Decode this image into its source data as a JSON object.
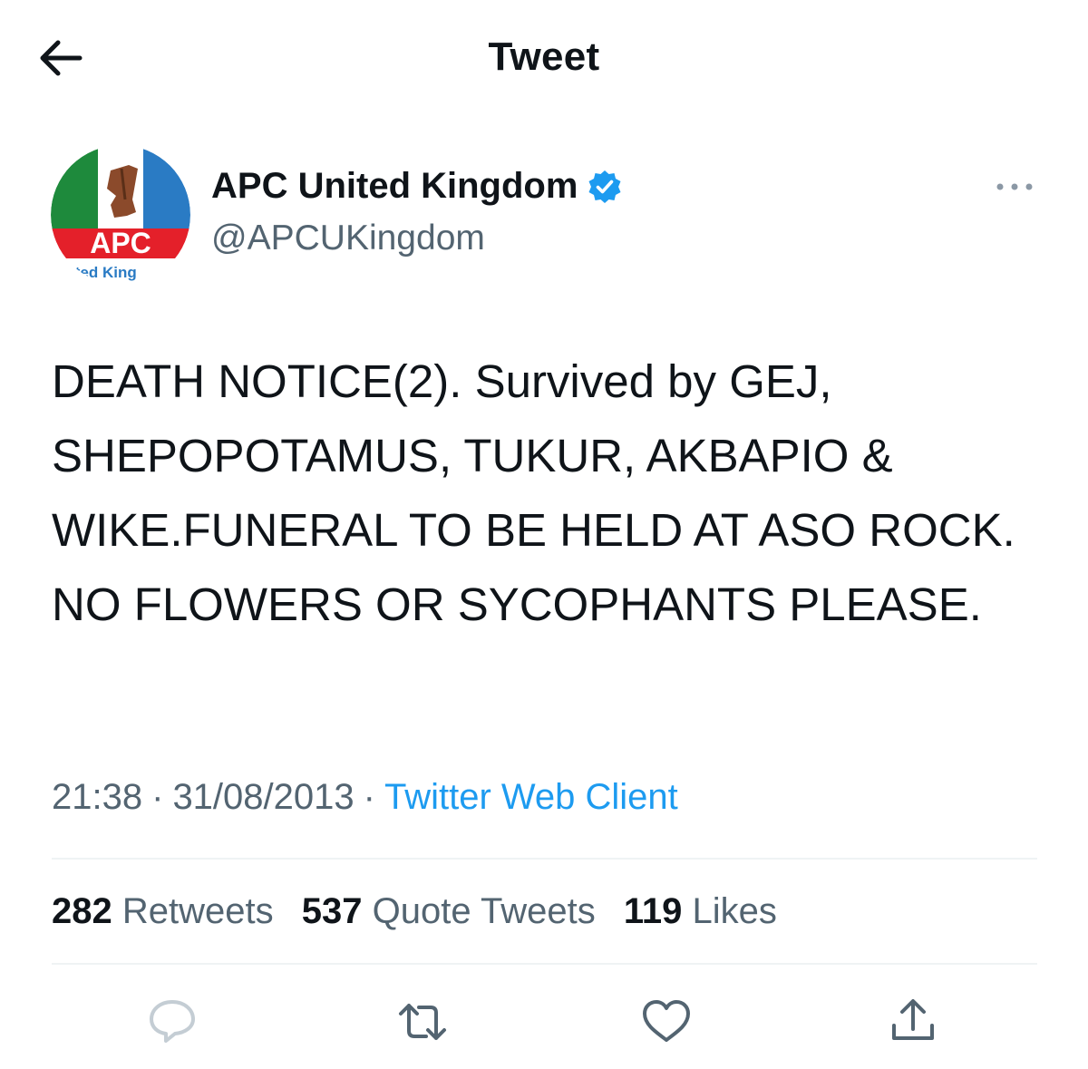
{
  "header": {
    "title": "Tweet",
    "back_icon": "arrow-left-icon"
  },
  "author": {
    "display_name": "APC United Kingdom",
    "handle": "@APCUKingdom",
    "verified": true,
    "avatar": {
      "logo_text": "APC",
      "caption": "ited King"
    }
  },
  "tweet": {
    "text": "DEATH NOTICE(2). Survived by GEJ, SHEPOPOTAMUS, TUKUR, AKBAPIO & WIKE.FUNERAL TO BE HELD AT ASO ROCK. NO FLOWERS OR SYCOPHANTS PLEASE.",
    "time": "21:38",
    "date": "31/08/2013",
    "separator": "·",
    "client": "Twitter Web Client"
  },
  "stats": {
    "retweets": {
      "count": "282",
      "label": "Retweets"
    },
    "quotes": {
      "count": "537",
      "label": "Quote Tweets"
    },
    "likes": {
      "count": "119",
      "label": "Likes"
    }
  },
  "actions": [
    "reply-icon",
    "retweet-icon",
    "like-icon",
    "share-icon"
  ],
  "colors": {
    "accent": "#1d9bf0",
    "text": "#0f1419",
    "secondary": "#536471",
    "divider": "#eff3f4"
  }
}
